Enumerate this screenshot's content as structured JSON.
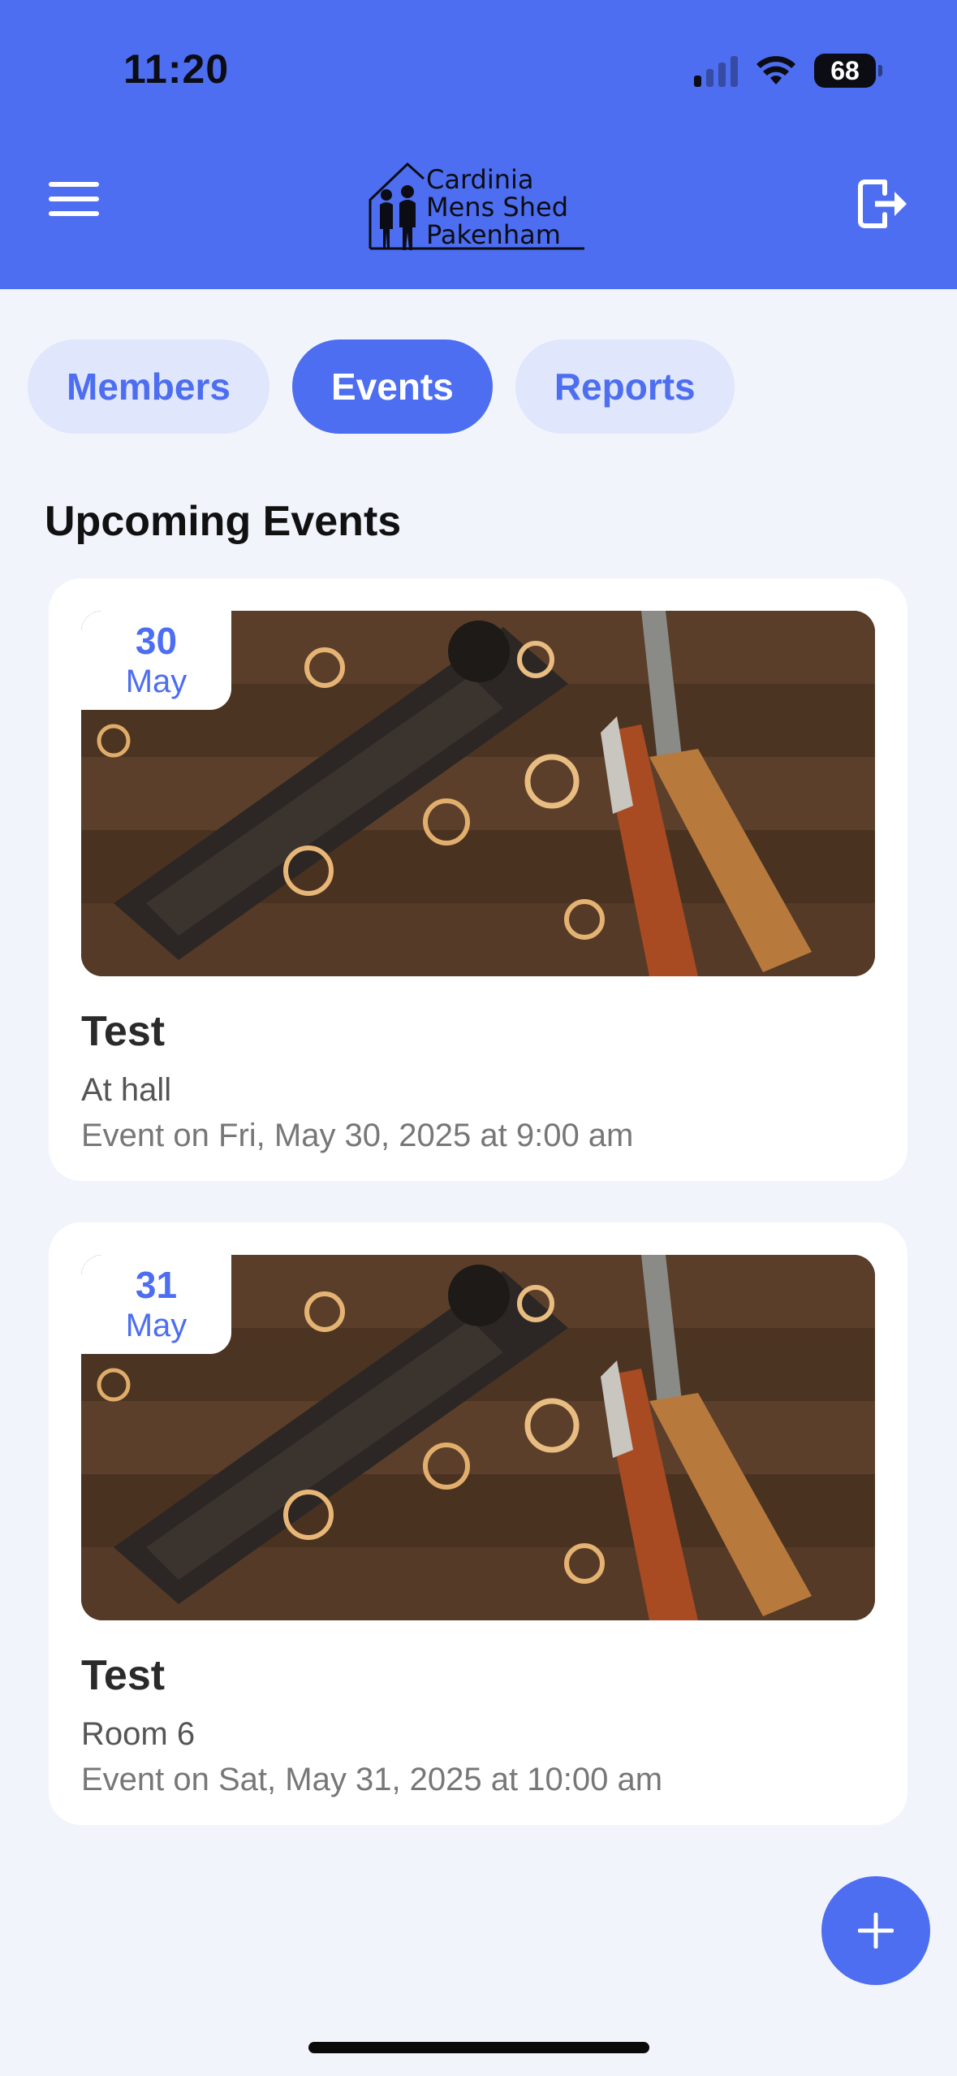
{
  "status_bar": {
    "time": "11:20",
    "battery": "68"
  },
  "header": {
    "logo_lines": [
      "Cardinia",
      "Mens Shed",
      "Pakenham"
    ]
  },
  "tabs": [
    {
      "label": "Members",
      "active": false
    },
    {
      "label": "Events",
      "active": true
    },
    {
      "label": "Reports",
      "active": false
    }
  ],
  "section_title": "Upcoming Events",
  "events": [
    {
      "day": "30",
      "month": "May",
      "title": "Test",
      "location": "At hall",
      "datetime": "Event on Fri, May 30, 2025 at 9:00 am"
    },
    {
      "day": "31",
      "month": "May",
      "title": "Test",
      "location": "Room 6",
      "datetime": "Event on Sat, May 31, 2025 at 10:00 am"
    }
  ],
  "colors": {
    "accent": "#4d6ef0",
    "background": "#f2f4fc"
  }
}
